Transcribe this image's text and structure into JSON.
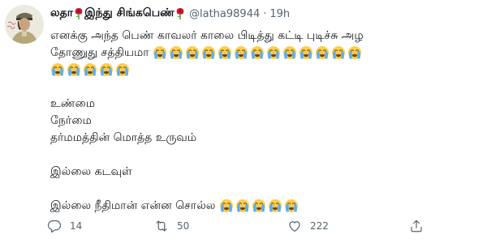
{
  "tweet": {
    "display_name_part1": "லதா",
    "display_name_part2": "இந்து சிங்கபெண்",
    "handle": "@latha98944",
    "separator": "·",
    "time": "19h",
    "body": {
      "line1": "எனக்கு அந்த பெண் காவலர் காலை பிடித்து கட்டி புடிச்சு அழ",
      "line2": "தோணுது சத்தியமா",
      "line2_emoji_count": 13,
      "line3_emoji_count": 5,
      "para2": [
        "உண்மை",
        "நேர்மை",
        "தர்மமத்தின் மொத்த உருவம்"
      ],
      "para3": "இல்லை கடவுள்",
      "para4": "இல்லை நீதிமான் என்ன சொல்ல",
      "para4_emoji_count": 5
    },
    "actions": {
      "reply_count": "14",
      "retweet_count": "50",
      "like_count": "222"
    },
    "emoji_name": "loudly-crying-face",
    "accent_color": "#1d9bf0",
    "muted_color": "#536471"
  }
}
